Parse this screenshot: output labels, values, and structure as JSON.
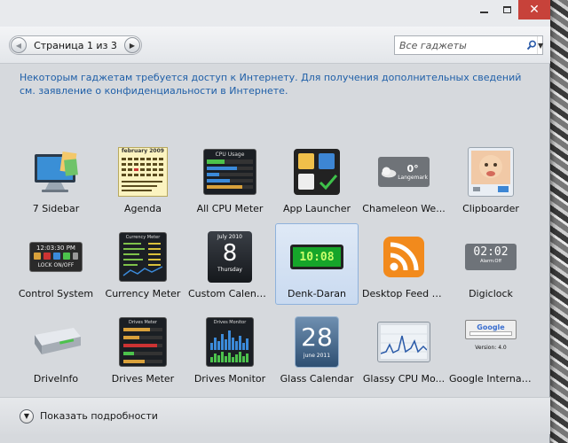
{
  "window": {
    "minimize_icon": "minimize-icon",
    "maximize_icon": "maximize-icon",
    "close_glyph": "✕"
  },
  "toolbar": {
    "page_label": "Страница 1 из 3",
    "prev_glyph": "◀",
    "next_glyph": "▶",
    "search_placeholder": "Все гаджеты",
    "dropdown_glyph": "▼"
  },
  "notice": "Некоторым гаджетам требуется доступ к Интернету. Для получения дополнительных сведений см. заявление о конфиденциальности в Интернете.",
  "gadgets": [
    {
      "label": "7 Sidebar",
      "icon": "monitor-icon"
    },
    {
      "label": "Agenda",
      "icon": "calendar-grid-icon",
      "thumb_text": "february 2009"
    },
    {
      "label": "All CPU Meter",
      "icon": "cpu-meter-icon",
      "thumb_text": "CPU Usage"
    },
    {
      "label": "App Launcher",
      "icon": "app-launcher-icon"
    },
    {
      "label": "Chameleon We...",
      "icon": "weather-icon",
      "thumb_text": "0°",
      "thumb_sub": "Langemark"
    },
    {
      "label": "Clipboarder",
      "icon": "photo-icon"
    },
    {
      "label": "Control System",
      "icon": "control-panel-icon",
      "thumb_text": "12:03:30 PM",
      "thumb_sub": "LOCK ON/OFF"
    },
    {
      "label": "Currency Meter",
      "icon": "currency-meter-icon",
      "thumb_text": "Currency Meter"
    },
    {
      "label": "Custom Calendar",
      "icon": "flip-calendar-icon",
      "thumb_text": "July 2010",
      "thumb_day": "8",
      "thumb_sub": "Thursday"
    },
    {
      "label": "Denk-Daran",
      "icon": "digital-clock-icon",
      "thumb_text": "10:08",
      "selected": true
    },
    {
      "label": "Desktop Feed R...",
      "icon": "rss-feed-icon"
    },
    {
      "label": "Digiclock",
      "icon": "digiclock-icon",
      "thumb_text": "02:02",
      "thumb_sub": "Alarm:Off"
    },
    {
      "label": "DriveInfo",
      "icon": "hard-drive-icon"
    },
    {
      "label": "Drives Meter",
      "icon": "drives-meter-icon",
      "thumb_text": "Drives Meter"
    },
    {
      "label": "Drives Monitor",
      "icon": "drives-monitor-icon",
      "thumb_text": "Drives Monitor"
    },
    {
      "label": "Glass Calendar",
      "icon": "glass-calendar-icon",
      "thumb_day": "28",
      "thumb_sub": "june 2011"
    },
    {
      "label": "Glassy CPU Mo...",
      "icon": "cpu-graph-icon"
    },
    {
      "label": "Google Internati...",
      "icon": "google-search-icon",
      "thumb_text": "Google",
      "thumb_sub": "Version: 4.0"
    }
  ],
  "footer": {
    "details_label": "Показать подробности",
    "chevron_glyph": "▼"
  },
  "colors": {
    "link_blue": "#1f5fa8",
    "close_red": "#c7423a",
    "selection": "#c9daf0",
    "rss_orange": "#f28a1c"
  }
}
